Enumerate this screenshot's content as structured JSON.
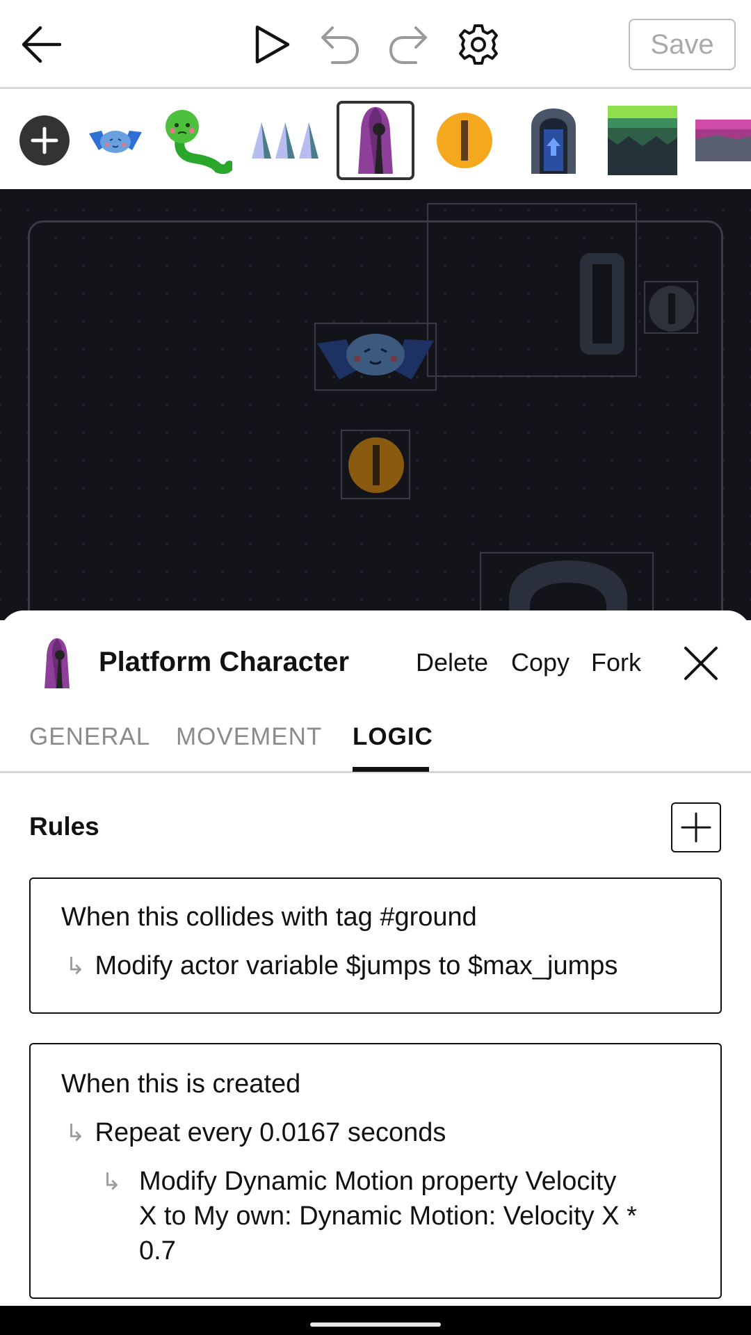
{
  "toolbar": {
    "back_icon": "arrow-left-icon",
    "play_icon": "play-icon",
    "undo_icon": "undo-icon",
    "redo_icon": "redo-icon",
    "settings_icon": "gear-icon",
    "save_label": "Save"
  },
  "palette": {
    "items": [
      {
        "icon": "add-icon",
        "selected": false
      },
      {
        "icon": "bat-icon",
        "selected": false
      },
      {
        "icon": "snake-icon",
        "selected": false
      },
      {
        "icon": "spikes-icon",
        "selected": false
      },
      {
        "icon": "hooded-character-icon",
        "selected": true
      },
      {
        "icon": "coin-icon",
        "selected": false
      },
      {
        "icon": "door-icon",
        "selected": false
      },
      {
        "icon": "grass-block-icon",
        "selected": false
      },
      {
        "icon": "pink-block-icon",
        "selected": false
      }
    ]
  },
  "sheet": {
    "actor_icon": "hooded-character-icon",
    "title": "Platform Character",
    "actions": {
      "delete": "Delete",
      "copy": "Copy",
      "fork": "Fork"
    },
    "close_icon": "close-icon",
    "tabs": [
      {
        "label": "GENERAL",
        "active": false
      },
      {
        "label": "MOVEMENT",
        "active": false
      },
      {
        "label": "LOGIC",
        "active": true
      }
    ],
    "rules_title": "Rules",
    "add_rule_icon": "plus-icon",
    "rules": [
      {
        "trigger": "When this collides with tag #ground",
        "responses": [
          "Modify actor variable $jumps to $max_jumps"
        ]
      },
      {
        "trigger": "When this is created",
        "responses": [
          "Repeat every 0.0167 seconds"
        ],
        "nested": [
          "Modify Dynamic Motion property Velocity",
          "X to My own: Dynamic Motion: Velocity X *",
          "0.7"
        ]
      }
    ]
  },
  "colors": {
    "canvas_bg": "#13131a",
    "accent_dark": "#111111",
    "inactive_tab": "#8b8b8b"
  }
}
